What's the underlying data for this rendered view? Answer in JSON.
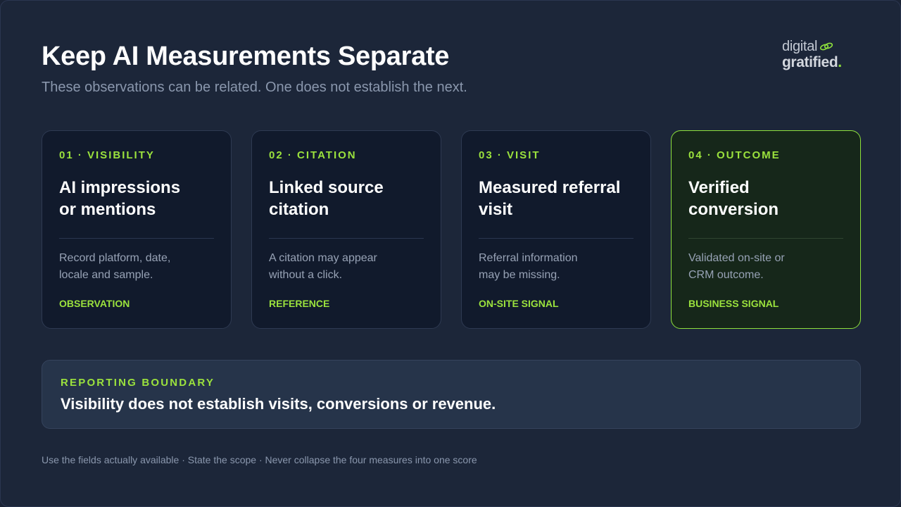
{
  "header": {
    "title": "Keep AI Measurements Separate",
    "subtitle": "These observations can be related. One does not establish the next."
  },
  "logo": {
    "line1": "digital",
    "line2": "gratified",
    "dot": ".",
    "icon": "link-icon",
    "accent_color": "#8ee13c"
  },
  "cards": [
    {
      "step": "01 · VISIBILITY",
      "heading_line1": "AI impressions",
      "heading_line2": "or mentions",
      "desc_line1": "Record platform, date,",
      "desc_line2": "locale and sample.",
      "tag": "OBSERVATION"
    },
    {
      "step": "02 · CITATION",
      "heading_line1": "Linked source",
      "heading_line2": "citation",
      "desc_line1": "A citation may appear",
      "desc_line2": "without a click.",
      "tag": "REFERENCE"
    },
    {
      "step": "03 · VISIT",
      "heading_line1": "Measured referral",
      "heading_line2": "visit",
      "desc_line1": "Referral information",
      "desc_line2": "may be missing.",
      "tag": "ON-SITE SIGNAL"
    },
    {
      "step": "04 · OUTCOME",
      "heading_line1": "Verified",
      "heading_line2": "conversion",
      "desc_line1": "Validated on-site or",
      "desc_line2": "CRM outcome.",
      "tag": "BUSINESS SIGNAL"
    }
  ],
  "boundary": {
    "label": "REPORTING BOUNDARY",
    "text": "Visibility does not establish visits, conversions or revenue."
  },
  "footer": {
    "text": "Use the fields actually available · State the scope · Never collapse the four measures into one score"
  },
  "colors": {
    "background": "#1c2639",
    "accent": "#9be23d",
    "card": "#111a2c",
    "highlight_card": "#16271a"
  }
}
